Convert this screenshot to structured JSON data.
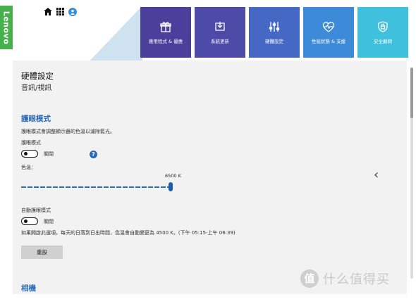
{
  "brand": {
    "name": "Lenovo",
    "color": "#46b04a"
  },
  "top_icons": [
    "home-icon",
    "apps-grid-icon",
    "user-account-icon"
  ],
  "tiles": [
    {
      "label": "應用程式 & 優惠",
      "icon": "gift-icon",
      "color": "#4b3f9c"
    },
    {
      "label": "系統更新",
      "icon": "system-update-icon",
      "color": "#4d4aa8"
    },
    {
      "label": "硬體設定",
      "icon": "sliders-icon",
      "color": "#4568c4"
    },
    {
      "label": "性能狀態 & 支援",
      "icon": "heart-pulse-icon",
      "color": "#3d8ad8"
    },
    {
      "label": "安全顧問",
      "icon": "shield-lock-icon",
      "color": "#3fc0dc"
    }
  ],
  "page": {
    "title": "硬體設定",
    "subtitle": "音訊/視訊"
  },
  "eye_care": {
    "section_title": "護眼模式",
    "description": "護眼模式會調整顯示器的色溫以濾除藍光。",
    "toggle_label": "護眼模式",
    "toggle_state": "關閉",
    "color_temp_label": "色溫：",
    "color_temp_value": "6500 K",
    "color_temp_level": 1.0,
    "auto_label": "自動護眼模式",
    "auto_state": "關閉",
    "auto_note": "如果開啟此選項，每天的日落到日出時間，色溫會自動變更為 4500 K。(下午 05:15-上午 06:39)",
    "reset_button": "重設"
  },
  "camera": {
    "section_title": "相機"
  },
  "watermark": {
    "logo": "值",
    "text": "什么值得买"
  }
}
